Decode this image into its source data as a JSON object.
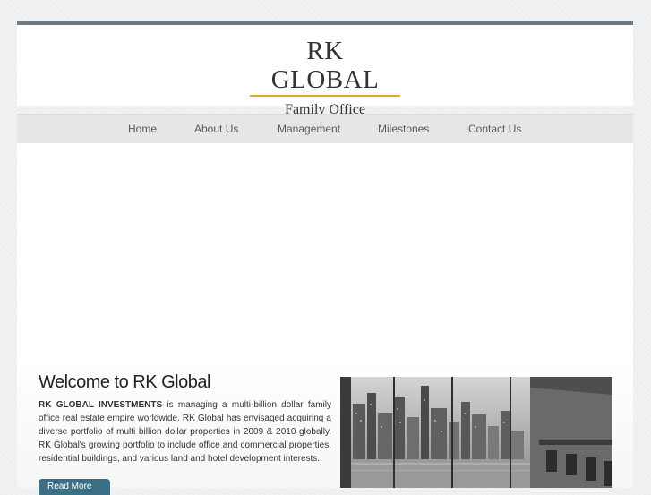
{
  "header": {
    "logo_title": "RK GLOBAL",
    "logo_subtitle": "Family Office",
    "accent": "#e0a630"
  },
  "nav": {
    "items": [
      {
        "label": "Home"
      },
      {
        "label": "About Us"
      },
      {
        "label": "Management"
      },
      {
        "label": "Milestones"
      },
      {
        "label": "Contact Us"
      }
    ]
  },
  "main": {
    "welcome_title": "Welcome to RK Global",
    "intro_bold": "RK GLOBAL INVESTMENTS",
    "intro_text": " is managing a multi-billion dollar family office real estate empire worldwide. RK Global has envisaged acquiring a diverse portfolio of multi billion dollar properties in 2009 & 2010 globally. RK Global's growing portfolio to include office and commercial properties, residential buildings, and various land and hotel development interests.",
    "read_more_label": "Read More",
    "read_more_color": "#3a6f86"
  }
}
